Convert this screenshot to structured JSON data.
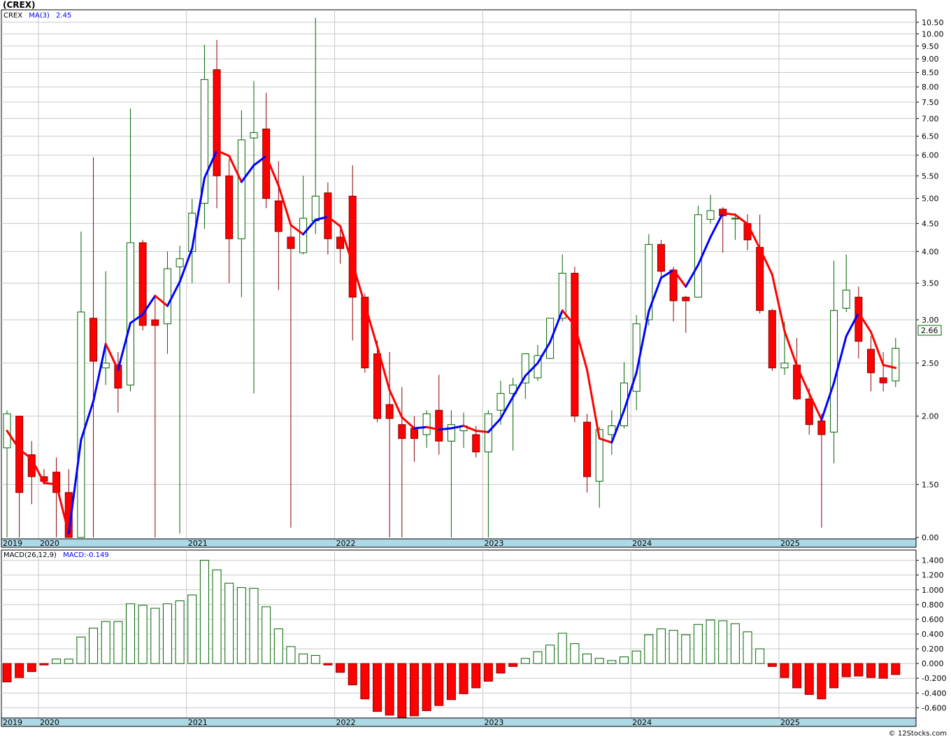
{
  "title": "(CREX)",
  "copyright": "© 12Stocks.com",
  "price_panel": {
    "symbol_label": "CREX",
    "ma_label": "MA(3)",
    "ma_value": "2.45",
    "last_price_label": "2.66"
  },
  "macd_panel": {
    "label": "MACD(26,12,9)",
    "value_label": "MACD:-0.149"
  },
  "colors": {
    "up": "#006400",
    "down": "#ff0000",
    "ma_rising": "#0000ff",
    "ma_falling": "#ff0000",
    "date_strip": "#add8e6",
    "grid": "#c8c8c8"
  },
  "chart_data": [
    {
      "type": "candlestick",
      "interval": "monthly",
      "y_scale": "log",
      "ylim": [
        1.2,
        11.0
      ],
      "yticks": [
        "10.50",
        "10.00",
        "9.50",
        "9.00",
        "8.50",
        "8.00",
        "7.50",
        "7.00",
        "6.50",
        "6.00",
        "5.50",
        "5.00",
        "4.50",
        "4.00",
        "3.50",
        "3.00",
        "2.50",
        "2.00",
        "1.50",
        "0.00"
      ],
      "year_labels": [
        "2019",
        "2020",
        "2021",
        "2022",
        "2023",
        "2024",
        "2025"
      ],
      "candles": [
        {
          "o": 1.75,
          "h": 2.05,
          "l": 1.2,
          "c": 2.02
        },
        {
          "o": 2.0,
          "h": 2.0,
          "l": 1.2,
          "c": 1.45
        },
        {
          "o": 1.7,
          "h": 1.8,
          "l": 1.38,
          "c": 1.55
        },
        {
          "o": 1.55,
          "h": 1.6,
          "l": 1.5,
          "c": 1.52
        },
        {
          "o": 1.58,
          "h": 1.68,
          "l": 1.2,
          "c": 1.45
        },
        {
          "o": 1.45,
          "h": 1.6,
          "l": 1.2,
          "c": 1.2
        },
        {
          "o": 1.2,
          "h": 4.35,
          "l": 1.2,
          "c": 3.1
        },
        {
          "o": 3.02,
          "h": 5.95,
          "l": 1.2,
          "c": 2.52
        },
        {
          "o": 2.45,
          "h": 3.68,
          "l": 2.28,
          "c": 2.5
        },
        {
          "o": 2.48,
          "h": 2.62,
          "l": 2.03,
          "c": 2.25
        },
        {
          "o": 2.28,
          "h": 7.3,
          "l": 2.22,
          "c": 4.15
        },
        {
          "o": 4.15,
          "h": 4.2,
          "l": 2.87,
          "c": 2.93
        },
        {
          "o": 3.0,
          "h": 3.3,
          "l": 1.2,
          "c": 2.93
        },
        {
          "o": 2.95,
          "h": 4.0,
          "l": 2.6,
          "c": 3.72
        },
        {
          "o": 3.75,
          "h": 4.1,
          "l": 1.22,
          "c": 3.88
        },
        {
          "o": 4.0,
          "h": 4.99,
          "l": 3.5,
          "c": 4.7
        },
        {
          "o": 4.9,
          "h": 9.55,
          "l": 4.4,
          "c": 8.25
        },
        {
          "o": 8.6,
          "h": 9.75,
          "l": 4.8,
          "c": 5.5
        },
        {
          "o": 5.5,
          "h": 5.9,
          "l": 3.5,
          "c": 4.22
        },
        {
          "o": 4.22,
          "h": 7.25,
          "l": 3.3,
          "c": 6.4
        },
        {
          "o": 6.45,
          "h": 8.2,
          "l": 2.2,
          "c": 6.6
        },
        {
          "o": 6.7,
          "h": 7.8,
          "l": 4.8,
          "c": 5.0
        },
        {
          "o": 4.95,
          "h": 5.85,
          "l": 3.4,
          "c": 4.35
        },
        {
          "o": 4.25,
          "h": 4.5,
          "l": 1.25,
          "c": 4.05
        },
        {
          "o": 3.98,
          "h": 5.5,
          "l": 3.95,
          "c": 4.6
        },
        {
          "o": 4.55,
          "h": 10.7,
          "l": 4.3,
          "c": 5.05
        },
        {
          "o": 5.12,
          "h": 5.35,
          "l": 3.95,
          "c": 4.22
        },
        {
          "o": 4.25,
          "h": 4.38,
          "l": 3.8,
          "c": 4.05
        },
        {
          "o": 5.05,
          "h": 5.75,
          "l": 2.75,
          "c": 3.3
        },
        {
          "o": 3.3,
          "h": 3.35,
          "l": 2.4,
          "c": 2.45
        },
        {
          "o": 2.6,
          "h": 2.75,
          "l": 1.95,
          "c": 1.98
        },
        {
          "o": 2.1,
          "h": 2.62,
          "l": 1.2,
          "c": 1.98
        },
        {
          "o": 1.93,
          "h": 2.26,
          "l": 1.2,
          "c": 1.82
        },
        {
          "o": 1.9,
          "h": 2.0,
          "l": 1.65,
          "c": 1.82
        },
        {
          "o": 1.85,
          "h": 2.05,
          "l": 1.75,
          "c": 2.02
        },
        {
          "o": 2.05,
          "h": 2.38,
          "l": 1.7,
          "c": 1.8
        },
        {
          "o": 1.8,
          "h": 2.05,
          "l": 1.2,
          "c": 1.93
        },
        {
          "o": 1.88,
          "h": 2.03,
          "l": 1.75,
          "c": 1.92
        },
        {
          "o": 1.85,
          "h": 1.92,
          "l": 1.68,
          "c": 1.72
        },
        {
          "o": 1.72,
          "h": 2.05,
          "l": 1.2,
          "c": 2.02
        },
        {
          "o": 2.05,
          "h": 2.32,
          "l": 1.93,
          "c": 2.2
        },
        {
          "o": 2.2,
          "h": 2.35,
          "l": 1.73,
          "c": 2.28
        },
        {
          "o": 2.3,
          "h": 2.6,
          "l": 2.15,
          "c": 2.6
        },
        {
          "o": 2.35,
          "h": 2.7,
          "l": 2.32,
          "c": 2.58
        },
        {
          "o": 2.55,
          "h": 3.02,
          "l": 2.55,
          "c": 3.02
        },
        {
          "o": 3.02,
          "h": 3.95,
          "l": 2.98,
          "c": 3.65
        },
        {
          "o": 3.65,
          "h": 3.75,
          "l": 1.95,
          "c": 2.0
        },
        {
          "o": 1.95,
          "h": 2.02,
          "l": 1.45,
          "c": 1.55
        },
        {
          "o": 1.52,
          "h": 1.91,
          "l": 1.36,
          "c": 1.89
        },
        {
          "o": 1.85,
          "h": 2.05,
          "l": 1.7,
          "c": 1.92
        },
        {
          "o": 1.92,
          "h": 2.51,
          "l": 1.9,
          "c": 2.3
        },
        {
          "o": 2.22,
          "h": 3.06,
          "l": 2.05,
          "c": 2.95
        },
        {
          "o": 3.0,
          "h": 4.3,
          "l": 2.93,
          "c": 4.12
        },
        {
          "o": 4.12,
          "h": 4.2,
          "l": 3.55,
          "c": 3.68
        },
        {
          "o": 3.7,
          "h": 3.75,
          "l": 2.98,
          "c": 3.25
        },
        {
          "o": 3.3,
          "h": 3.32,
          "l": 2.84,
          "c": 3.25
        },
        {
          "o": 3.3,
          "h": 4.85,
          "l": 3.3,
          "c": 4.67
        },
        {
          "o": 4.58,
          "h": 5.08,
          "l": 4.5,
          "c": 4.75
        },
        {
          "o": 4.78,
          "h": 4.82,
          "l": 3.98,
          "c": 4.65
        },
        {
          "o": 4.6,
          "h": 4.7,
          "l": 4.2,
          "c": 4.6
        },
        {
          "o": 4.5,
          "h": 4.68,
          "l": 4.02,
          "c": 4.2
        },
        {
          "o": 4.07,
          "h": 4.67,
          "l": 3.08,
          "c": 3.12
        },
        {
          "o": 3.12,
          "h": 3.14,
          "l": 2.42,
          "c": 2.45
        },
        {
          "o": 2.45,
          "h": 2.98,
          "l": 2.38,
          "c": 2.5
        },
        {
          "o": 2.48,
          "h": 2.78,
          "l": 2.14,
          "c": 2.15
        },
        {
          "o": 2.15,
          "h": 2.25,
          "l": 1.85,
          "c": 1.93
        },
        {
          "o": 1.96,
          "h": 2.02,
          "l": 1.25,
          "c": 1.85
        },
        {
          "o": 1.87,
          "h": 3.85,
          "l": 1.64,
          "c": 3.12
        },
        {
          "o": 3.15,
          "h": 3.95,
          "l": 3.1,
          "c": 3.4
        },
        {
          "o": 3.3,
          "h": 3.45,
          "l": 2.55,
          "c": 2.74
        },
        {
          "o": 2.65,
          "h": 2.8,
          "l": 2.22,
          "c": 2.4
        },
        {
          "o": 2.35,
          "h": 2.62,
          "l": 2.22,
          "c": 2.3
        },
        {
          "o": 2.32,
          "h": 2.78,
          "l": 2.26,
          "c": 2.66
        }
      ],
      "ma3": [
        1.88,
        1.74,
        1.67,
        1.51,
        1.5,
        1.22,
        1.81,
        2.13,
        2.71,
        2.43,
        2.96,
        3.07,
        3.32,
        3.18,
        3.52,
        4.05,
        5.45,
        6.12,
        5.98,
        5.36,
        5.75,
        5.98,
        5.28,
        4.47,
        4.3,
        4.57,
        4.63,
        4.45,
        3.8,
        3.2,
        2.68,
        2.23,
        1.99,
        1.9,
        1.91,
        1.89,
        1.9,
        1.92,
        1.88,
        1.87,
        1.98,
        2.17,
        2.37,
        2.5,
        2.73,
        3.12,
        2.93,
        2.43,
        1.82,
        1.79,
        2.05,
        2.4,
        3.11,
        3.58,
        3.7,
        3.45,
        3.78,
        4.25,
        4.7,
        4.67,
        4.49,
        4.05,
        3.63,
        2.86,
        2.47,
        2.2,
        1.97,
        2.3,
        2.8,
        3.09,
        2.85,
        2.48,
        2.45
      ]
    },
    {
      "type": "bar",
      "series_label": "MACD(26,12,9)",
      "ylim": [
        -0.72,
        1.52
      ],
      "yticks": [
        "1.400",
        "1.200",
        "1.000",
        "0.800",
        "0.600",
        "0.400",
        "0.200",
        "0.000",
        "-0.200",
        "-0.400",
        "-0.600"
      ],
      "values": [
        -0.25,
        -0.19,
        -0.11,
        -0.02,
        0.06,
        0.06,
        0.36,
        0.48,
        0.57,
        0.57,
        0.81,
        0.79,
        0.75,
        0.81,
        0.85,
        0.93,
        1.4,
        1.27,
        1.09,
        1.03,
        1.02,
        0.77,
        0.47,
        0.23,
        0.13,
        0.11,
        -0.02,
        -0.12,
        -0.29,
        -0.48,
        -0.65,
        -0.7,
        -0.73,
        -0.71,
        -0.64,
        -0.57,
        -0.49,
        -0.41,
        -0.33,
        -0.24,
        -0.13,
        -0.04,
        0.07,
        0.16,
        0.25,
        0.41,
        0.27,
        0.13,
        0.07,
        0.04,
        0.09,
        0.17,
        0.39,
        0.47,
        0.45,
        0.39,
        0.53,
        0.59,
        0.58,
        0.54,
        0.43,
        0.2,
        -0.04,
        -0.19,
        -0.33,
        -0.42,
        -0.48,
        -0.33,
        -0.18,
        -0.17,
        -0.19,
        -0.2,
        -0.15
      ]
    }
  ]
}
